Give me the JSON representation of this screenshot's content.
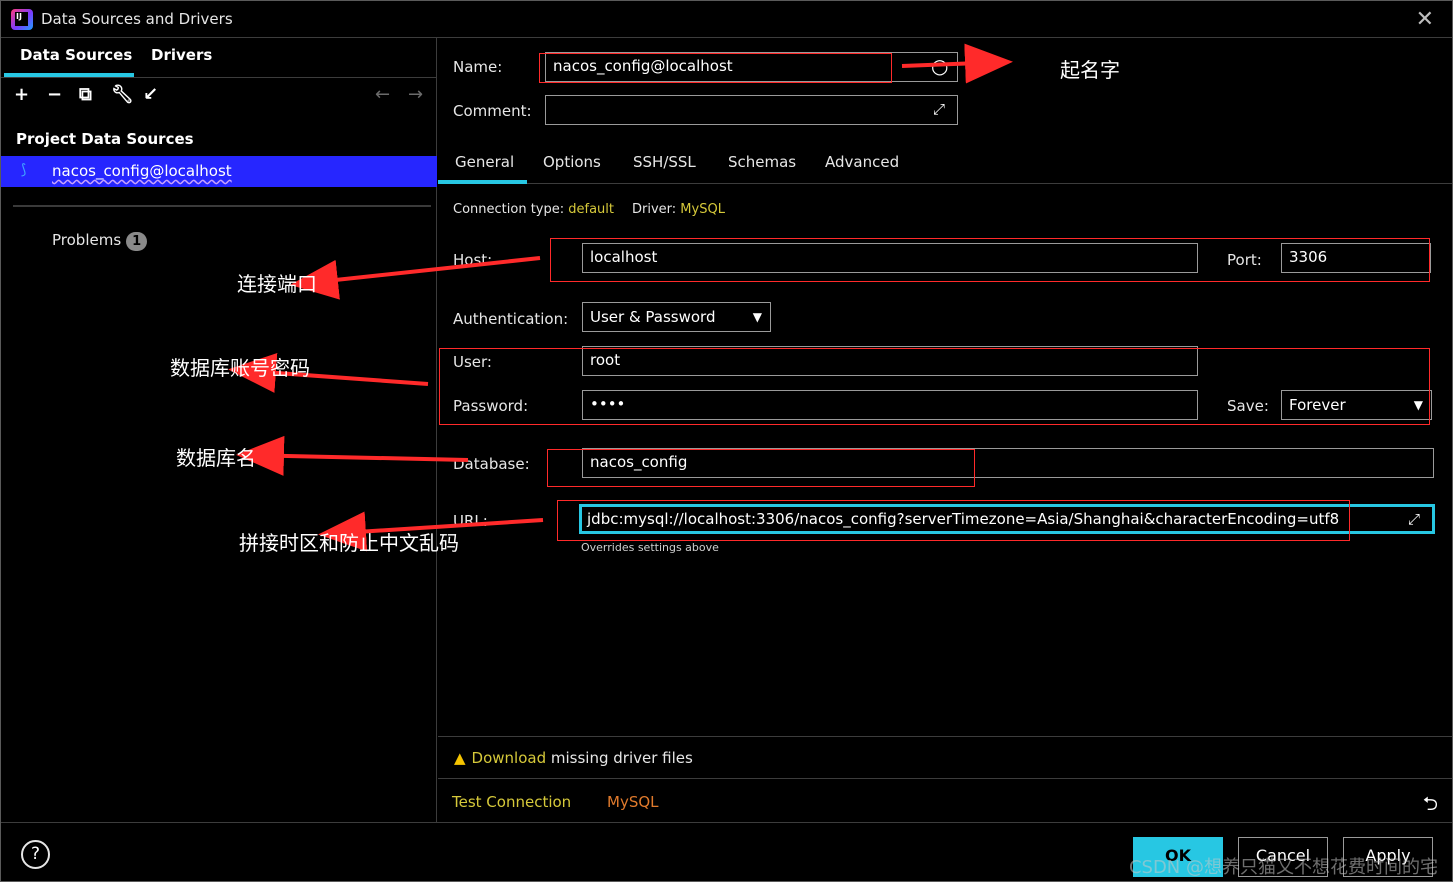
{
  "window": {
    "title": "Data Sources and Drivers",
    "close_glyph": "✕"
  },
  "left": {
    "tabs": [
      "Data Sources",
      "Drivers"
    ],
    "section_title": "Project Data Sources",
    "datasource": "nacos_config@localhost",
    "problems_label": "Problems",
    "problems_count": "1"
  },
  "form": {
    "name_label": "Name:",
    "name_value": "nacos_config@localhost",
    "comment_label": "Comment:",
    "comment_value": "",
    "tabs": [
      "General",
      "Options",
      "SSH/SSL",
      "Schemas",
      "Advanced"
    ],
    "conn_type_label": "Connection type:",
    "conn_type_value": "default",
    "driver_label": "Driver:",
    "driver_value": "MySQL",
    "host_label": "Host:",
    "host_value": "localhost",
    "port_label": "Port:",
    "port_value": "3306",
    "auth_label": "Authentication:",
    "auth_value": "User & Password",
    "user_label": "User:",
    "user_value": "root",
    "password_label": "Password:",
    "password_value": "••••",
    "save_label": "Save:",
    "save_value": "Forever",
    "database_label": "Database:",
    "database_value": "nacos_config",
    "url_label": "URL:",
    "url_value": "jdbc:mysql://localhost:3306/nacos_config?serverTimezone=Asia/Shanghai&characterEncoding=utf8",
    "url_hint": "Overrides settings above"
  },
  "bottom": {
    "download_link": "Download",
    "download_rest": " missing driver files",
    "test_connection": "Test Connection",
    "driver_name": "MySQL"
  },
  "footer": {
    "help": "?",
    "ok": "OK",
    "cancel": "Cancel",
    "apply": "Apply",
    "watermark": "CSDN @想养只猫又不想花费时间的宅"
  },
  "annotations": [
    "起名字",
    "连接端口",
    "数据库账号密码",
    "数据库名",
    "拼接时区和防止中文乱码"
  ],
  "colors": {
    "accent": "#27c7e3",
    "selection": "#2626ff",
    "annotation": "#ff2a2a",
    "value_yellow": "#d6c93a",
    "driver_orange": "#e07a2c"
  }
}
